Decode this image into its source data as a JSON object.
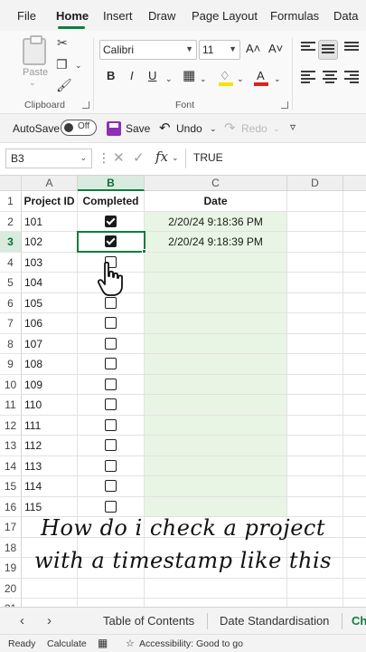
{
  "ribbon_tabs": [
    "File",
    "Home",
    "Insert",
    "Draw",
    "Page Layout",
    "Formulas",
    "Data"
  ],
  "ribbon": {
    "clipboard_label": "Clipboard",
    "paste_label": "Paste",
    "font_label": "Font",
    "font_name": "Calibri",
    "font_size": "11",
    "bold": "B",
    "italic": "I",
    "underline": "U",
    "grow_font": "A˄",
    "shrink_font": "A˅",
    "font_color_letter": "A",
    "highlight_color": "#f5e20b",
    "font_color": "#e02020"
  },
  "qat": {
    "autosave_label": "AutoSave",
    "toggle_state": "Off",
    "save_label": "Save",
    "undo_label": "Undo",
    "redo_label": "Redo"
  },
  "formula_bar": {
    "name_box": "B3",
    "fx": "fx",
    "value": "TRUE"
  },
  "columns": [
    "A",
    "B",
    "C",
    "D"
  ],
  "headers": {
    "a": "Project ID",
    "b": "Completed",
    "c": "Date"
  },
  "rows": [
    {
      "num": "1"
    },
    {
      "num": "2",
      "id": "101",
      "checked": true,
      "date": "2/20/24 9:18:36 PM"
    },
    {
      "num": "3",
      "id": "102",
      "checked": true,
      "date": "2/20/24 9:18:39 PM"
    },
    {
      "num": "4",
      "id": "103",
      "checked": false,
      "date": ""
    },
    {
      "num": "5",
      "id": "104",
      "checked": false,
      "date": ""
    },
    {
      "num": "6",
      "id": "105",
      "checked": false,
      "date": ""
    },
    {
      "num": "7",
      "id": "106",
      "checked": false,
      "date": ""
    },
    {
      "num": "8",
      "id": "107",
      "checked": false,
      "date": ""
    },
    {
      "num": "9",
      "id": "108",
      "checked": false,
      "date": ""
    },
    {
      "num": "10",
      "id": "109",
      "checked": false,
      "date": ""
    },
    {
      "num": "11",
      "id": "110",
      "checked": false,
      "date": ""
    },
    {
      "num": "12",
      "id": "111",
      "checked": false,
      "date": ""
    },
    {
      "num": "13",
      "id": "112",
      "checked": false,
      "date": ""
    },
    {
      "num": "14",
      "id": "113",
      "checked": false,
      "date": ""
    },
    {
      "num": "15",
      "id": "114",
      "checked": false,
      "date": ""
    },
    {
      "num": "16",
      "id": "115",
      "checked": false,
      "date": ""
    },
    {
      "num": "17"
    },
    {
      "num": "18"
    },
    {
      "num": "19"
    },
    {
      "num": "20"
    },
    {
      "num": "21"
    }
  ],
  "caption": {
    "line1": "How do i check a project",
    "line2": "with a timestamp like this"
  },
  "sheet_tabs": [
    "Table of Contents",
    "Date Standardisation",
    "Ch"
  ],
  "status": {
    "ready": "Ready",
    "calculate": "Calculate",
    "accessibility": "Accessibility: Good to go"
  },
  "colors": {
    "accent": "#107c41",
    "date_fill": "#e9f5e4"
  }
}
